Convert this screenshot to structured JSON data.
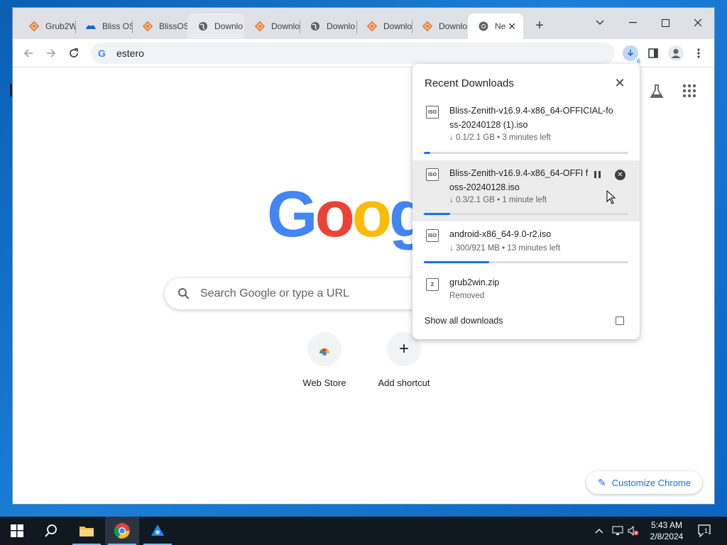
{
  "browser": {
    "tabs": [
      {
        "title": "Grub2W",
        "icon": "sourceforge-icon"
      },
      {
        "title": "Bliss OS",
        "icon": "bliss-icon"
      },
      {
        "title": "BlissOS",
        "icon": "sourceforge-icon"
      },
      {
        "title": "Downlo",
        "icon": "globe-icon"
      },
      {
        "title": "Downlo",
        "icon": "sourceforge-icon"
      },
      {
        "title": "Downlo",
        "icon": "globe-icon"
      },
      {
        "title": "Downlo",
        "icon": "sourceforge-icon"
      },
      {
        "title": "Downlo",
        "icon": "sourceforge-icon"
      },
      {
        "title": "Ne",
        "icon": "chrome-icon",
        "active": true
      }
    ],
    "new_tab_symbol": "+",
    "omnibox_text": "estero",
    "download_count": "6",
    "colors": {
      "accent": "#1a73e8",
      "tabstrip": "#dee1e6"
    }
  },
  "ntp": {
    "logo_letters": [
      {
        "ch": "G",
        "color": "#4285f4"
      },
      {
        "ch": "o",
        "color": "#ea4335"
      },
      {
        "ch": "o",
        "color": "#fbbc05"
      },
      {
        "ch": "g",
        "color": "#4285f4"
      }
    ],
    "search_placeholder": "Search Google or type a URL",
    "shortcuts": [
      {
        "label": "Web Store"
      },
      {
        "label": "Add shortcut",
        "symbol": "+"
      }
    ],
    "customize_label": "Customize Chrome"
  },
  "downloads": {
    "title": "Recent Downloads",
    "items": [
      {
        "name": "Bliss-Zenith-v16.9.4-x86_64-OFFICIAL-foss-20240128 (1).iso",
        "status": "↓ 0.1/2.1 GB • 3 minutes left",
        "progress": 0.03,
        "type": "ISO"
      },
      {
        "name": "Bliss-Zenith-v16.9.4-x86_64-OFFI foss-20240128.iso",
        "status": "↓ 0.3/2.1 GB • 1 minute left",
        "progress": 0.13,
        "type": "ISO"
      },
      {
        "name": "android-x86_64-9.0-r2.iso",
        "status": "↓ 300/921 MB • 13 minutes left",
        "progress": 0.32,
        "type": "ISO"
      },
      {
        "name": "grub2win.zip",
        "status": "Removed",
        "type": "Z"
      }
    ],
    "show_all_label": "Show all downloads"
  },
  "taskbar": {
    "time": "5:43 AM",
    "date": "2/8/2024",
    "notification_count": "1"
  }
}
